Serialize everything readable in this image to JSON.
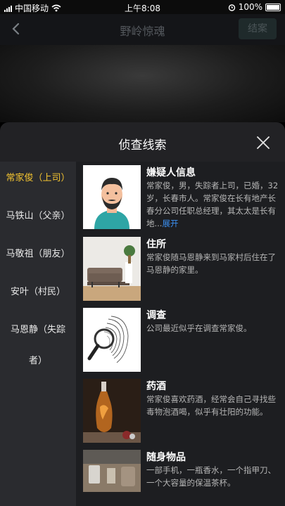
{
  "status": {
    "carrier": "中国移动",
    "time": "上午8:08",
    "battery": "100%"
  },
  "nav": {
    "title": "野岭惊魂",
    "close_case": "结案"
  },
  "sheet": {
    "title": "侦查线索"
  },
  "sidebar": {
    "items": [
      {
        "label": "常家俊（上司）"
      },
      {
        "label": "马铁山（父亲）"
      },
      {
        "label": "马敬祖（朋友）"
      },
      {
        "label": "安叶（村民）"
      },
      {
        "label": "马恩静（失踪"
      },
      {
        "label": "者）"
      }
    ]
  },
  "clues": [
    {
      "title": "嫌疑人信息",
      "desc": "常家俊，男，失踪者上司，已婚，32岁，长春市人。常家俊在长有地产长春分公司任职总经理，其太太是长有地...",
      "expand": "展开",
      "icon": "suspect-avatar"
    },
    {
      "title": "住所",
      "desc": "常家俊随马恩静来到马家村后住在了马恩静的家里。",
      "icon": "living-room-photo"
    },
    {
      "title": "调查",
      "desc": "公司最近似乎在调查常家俊。",
      "icon": "magnifier-fingerprint"
    },
    {
      "title": "药酒",
      "desc": "常家俊喜欢药酒，经常会自己寻找些毒物泡酒喝，似乎有壮阳的功能。",
      "icon": "liquor-bottle-photo"
    },
    {
      "title": "随身物品",
      "desc": "一部手机，一瓶香水，一个指甲刀、一个大容量的保温茶杯。",
      "icon": "personal-items-photo"
    }
  ]
}
